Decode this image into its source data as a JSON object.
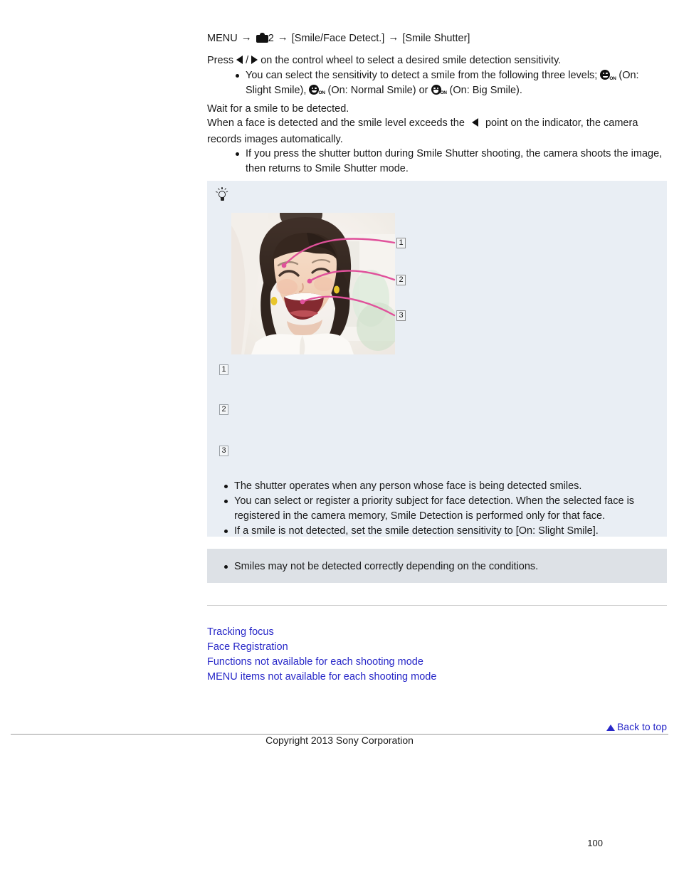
{
  "menu_path": {
    "menu_label": "MENU",
    "arrow": "→",
    "camera_icon": "camera-icon",
    "camera_tab": "2",
    "item1": "[Smile/Face Detect.]",
    "item2": "[Smile Shutter]"
  },
  "steps": {
    "press_prefix": "Press",
    "slash": "/",
    "press_suffix": "on the control wheel to select a desired smile detection sensitivity.",
    "sensitivity_bullet_a": "You can select the sensitivity to detect a smile from the following three levels;",
    "sensitivity_slight": "(On: Slight Smile),",
    "sensitivity_normal": "(On: Normal Smile) or",
    "sensitivity_big": "(On: Big Smile).",
    "icon_on_label": "ON",
    "wait_line": "Wait for a smile to be detected.",
    "exceed_prefix": "When a face is detected and the smile level exceeds the",
    "exceed_suffix": "point on the indicator, the camera",
    "exceed_line2": "records images automatically.",
    "shutter_bullet": "If you press the shutter button during Smile Shutter shooting, the camera shoots the image, then returns to Smile Shutter mode."
  },
  "tip_box": {
    "icon": "light-bulb-icon",
    "figure_alt": "Smiling child with three pink callout lines",
    "figure_callouts": [
      {
        "number": "1",
        "text": ""
      },
      {
        "number": "2",
        "text": ""
      },
      {
        "number": "3",
        "text": ""
      }
    ],
    "callouts": [
      {
        "number": "1",
        "text": ""
      },
      {
        "number": "2",
        "text": ""
      },
      {
        "number": "3",
        "text": ""
      }
    ],
    "bullets": [
      "The shutter operates when any person whose face is being detected smiles.",
      "You can select or register a priority subject for face detection. When the selected face is registered in the camera memory, Smile Detection is performed only for that face.",
      "If a smile is not detected, set the smile detection sensitivity to [On: Slight Smile]."
    ]
  },
  "note_box": {
    "bullets": [
      "Smiles may not be detected correctly depending on the conditions."
    ]
  },
  "related_links": [
    "Tracking focus",
    "Face Registration",
    "Functions not available for each shooting mode",
    "MENU items not available for each shooting mode"
  ],
  "footer": {
    "back_to_top": "Back to top",
    "back_to_top_icon": "up-triangle-icon",
    "copyright": "Copyright 2013 Sony Corporation",
    "page_number": "100"
  },
  "colors": {
    "link": "#2828c8",
    "tip_bg": "#e9eef4",
    "note_bg": "#dde1e6",
    "callout_line": "#e0519b",
    "text": "#1a1a1a"
  }
}
